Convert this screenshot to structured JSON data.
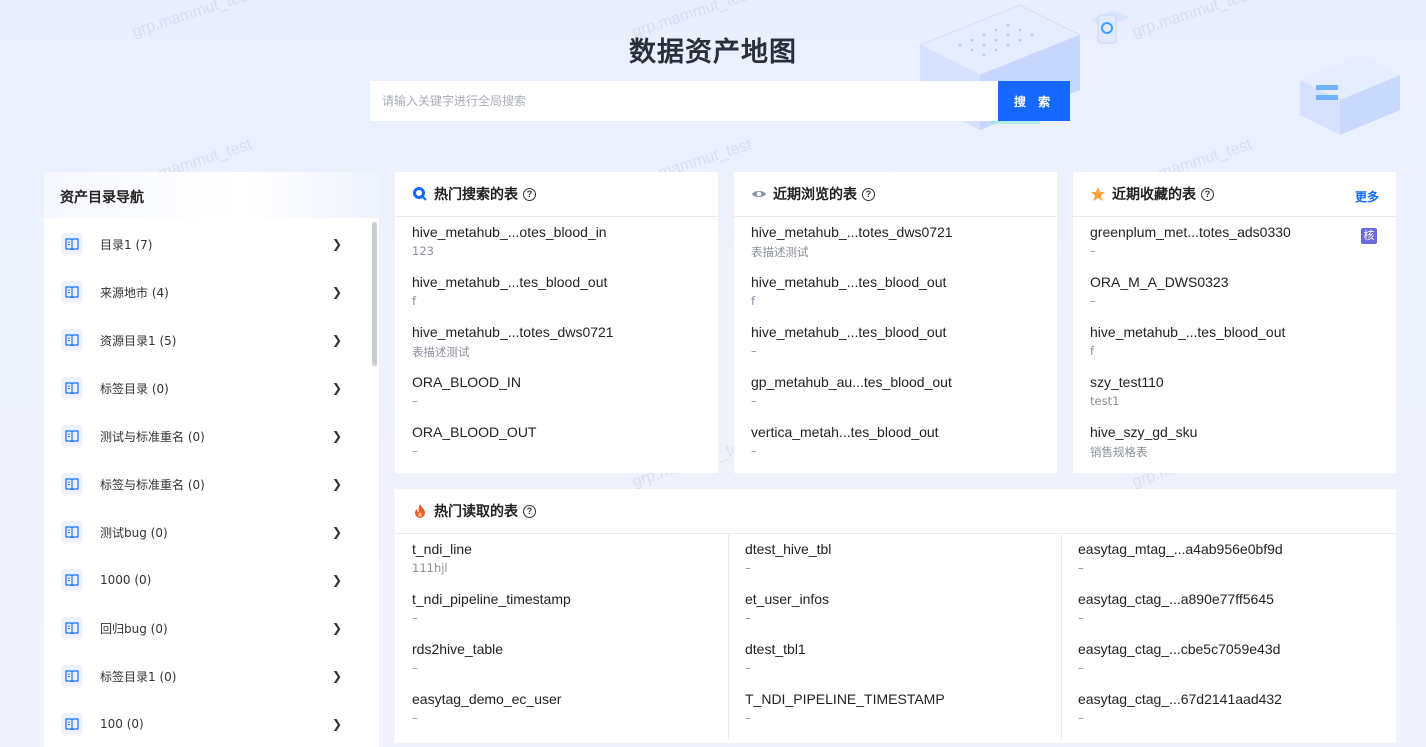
{
  "watermark": "grp.mammut_test",
  "header": {
    "title": "数据资产地图",
    "search_placeholder": "请输入关键字进行全局搜索",
    "search_button": "搜 索"
  },
  "colors": {
    "accent": "#1668ff",
    "badge": "#6b6bdf",
    "hot": "#f05a28",
    "star": "#f7a23b"
  },
  "sidebar": {
    "title": "资产目录导航",
    "items": [
      {
        "label": "目录1 (7)",
        "icon": "book-icon"
      },
      {
        "label": "来源地市 (4)",
        "icon": "book-icon"
      },
      {
        "label": "资源目录1 (5)",
        "icon": "book-icon"
      },
      {
        "label": "标签目录 (0)",
        "icon": "book-icon"
      },
      {
        "label": "测试与标准重名 (0)",
        "icon": "book-icon"
      },
      {
        "label": "标签与标准重名 (0)",
        "icon": "book-icon"
      },
      {
        "label": "测试bug (0)",
        "icon": "book-icon"
      },
      {
        "label": "1000 (0)",
        "icon": "book-icon"
      },
      {
        "label": "回归bug (0)",
        "icon": "book-icon"
      },
      {
        "label": "标签目录1 (0)",
        "icon": "book-icon"
      },
      {
        "label": "100 (0)",
        "icon": "book-icon"
      }
    ]
  },
  "hot_search": {
    "title": "热门搜索的表",
    "icon": "search-bubble-icon",
    "items": [
      {
        "name": "hive_metahub_...otes_blood_in",
        "desc": "123"
      },
      {
        "name": "hive_metahub_...tes_blood_out",
        "desc": "f"
      },
      {
        "name": "hive_metahub_...totes_dws0721",
        "desc": "表描述测试"
      },
      {
        "name": "ORA_BLOOD_IN",
        "desc": "–"
      },
      {
        "name": "ORA_BLOOD_OUT",
        "desc": "–"
      }
    ]
  },
  "recent_view": {
    "title": "近期浏览的表",
    "icon": "eye-icon",
    "items": [
      {
        "name": "hive_metahub_...totes_dws0721",
        "desc": "表描述测试"
      },
      {
        "name": "hive_metahub_...tes_blood_out",
        "desc": "f"
      },
      {
        "name": "hive_metahub_...tes_blood_out",
        "desc": "–"
      },
      {
        "name": "gp_metahub_au...tes_blood_out",
        "desc": "–"
      },
      {
        "name": "vertica_metah...tes_blood_out",
        "desc": "–"
      }
    ]
  },
  "recent_fav": {
    "title": "近期收藏的表",
    "icon": "star-icon",
    "more": "更多",
    "badge": "核",
    "items": [
      {
        "name": "greenplum_met...totes_ads0330",
        "desc": "–"
      },
      {
        "name": "ORA_M_A_DWS0323",
        "desc": "–"
      },
      {
        "name": "hive_metahub_...tes_blood_out",
        "desc": "f"
      },
      {
        "name": "szy_test110",
        "desc": "test1"
      },
      {
        "name": "hive_szy_gd_sku",
        "desc": "销售规格表"
      }
    ]
  },
  "hot_read": {
    "title": "热门读取的表",
    "icon": "flame-icon",
    "columns": [
      [
        {
          "name": "t_ndi_line",
          "desc": "111hjl"
        },
        {
          "name": "t_ndi_pipeline_timestamp",
          "desc": "–"
        },
        {
          "name": "rds2hive_table",
          "desc": "–"
        },
        {
          "name": "easytag_demo_ec_user",
          "desc": "–"
        }
      ],
      [
        {
          "name": "dtest_hive_tbl",
          "desc": "–"
        },
        {
          "name": "et_user_infos",
          "desc": "–"
        },
        {
          "name": "dtest_tbl1",
          "desc": "–"
        },
        {
          "name": "T_NDI_PIPELINE_TIMESTAMP",
          "desc": "–"
        }
      ],
      [
        {
          "name": "easytag_mtag_...a4ab956e0bf9d",
          "desc": "–"
        },
        {
          "name": "easytag_ctag_...a890e77ff5645",
          "desc": "–"
        },
        {
          "name": "easytag_ctag_...cbe5c7059e43d",
          "desc": "–"
        },
        {
          "name": "easytag_ctag_...67d2141aad432",
          "desc": "–"
        }
      ]
    ]
  }
}
